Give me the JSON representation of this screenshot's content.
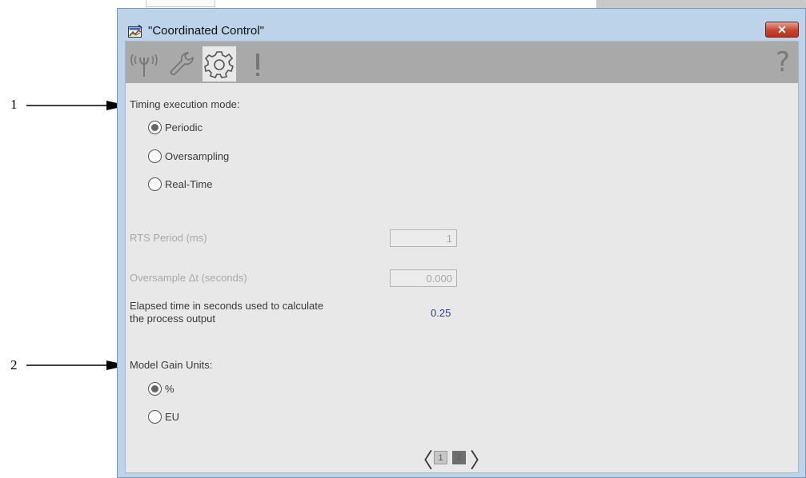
{
  "callouts": [
    "1",
    "2"
  ],
  "window": {
    "title": "\"Coordinated Control\"",
    "close_label": "✕",
    "help_label": "?"
  },
  "toolbar": {
    "tabs": [
      {
        "icon": "signal-icon",
        "active": false
      },
      {
        "icon": "wrench-icon",
        "active": false
      },
      {
        "icon": "gear-icon",
        "active": true
      },
      {
        "icon": "alarm-exclamation-icon",
        "active": false
      }
    ]
  },
  "timing": {
    "heading": "Timing execution mode:",
    "options": [
      "Periodic",
      "Oversampling",
      "Real-Time"
    ],
    "selected": "Periodic"
  },
  "rts_period": {
    "label": "RTS Period (ms)",
    "value": "1"
  },
  "oversample": {
    "label": "Oversample Δt  (seconds)",
    "value": "0.000"
  },
  "elapsed": {
    "label_line1": "Elapsed time in seconds used to calculate",
    "label_line2": "the process output",
    "value": "0.25"
  },
  "gain_units": {
    "heading": "Model Gain Units:",
    "options": [
      "%",
      "EU"
    ],
    "selected": "%"
  },
  "pager": {
    "prev": "〈",
    "next": "〉",
    "pages": [
      "1",
      "2"
    ],
    "current": "2"
  },
  "colors": {
    "window_frame": "#bdd3ea",
    "close_button": "#c7452f",
    "value_text": "#2b3f9a"
  }
}
